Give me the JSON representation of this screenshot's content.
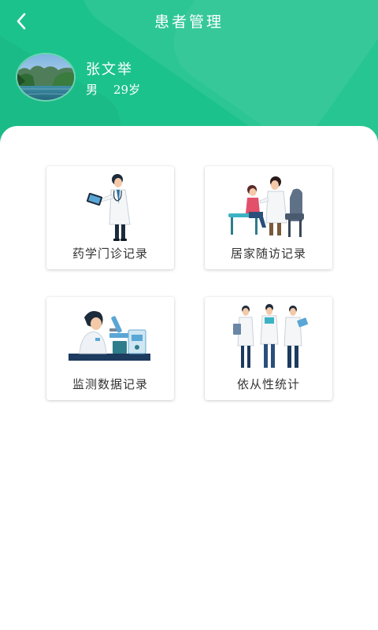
{
  "header": {
    "title": "患者管理",
    "back_icon": "chevron-left-icon",
    "accent_color": "#1cc28c"
  },
  "patient": {
    "name": "张文举",
    "gender": "男",
    "age": "29岁",
    "avatar": "landscape-lake-photo"
  },
  "cards": [
    {
      "label": "药学门诊记录",
      "icon": "doctor-with-tablet-illustration"
    },
    {
      "label": "居家随访记录",
      "icon": "doctor-examining-child-illustration"
    },
    {
      "label": "监测数据记录",
      "icon": "scientist-microscope-illustration"
    },
    {
      "label": "依从性统计",
      "icon": "medical-team-illustration"
    }
  ]
}
